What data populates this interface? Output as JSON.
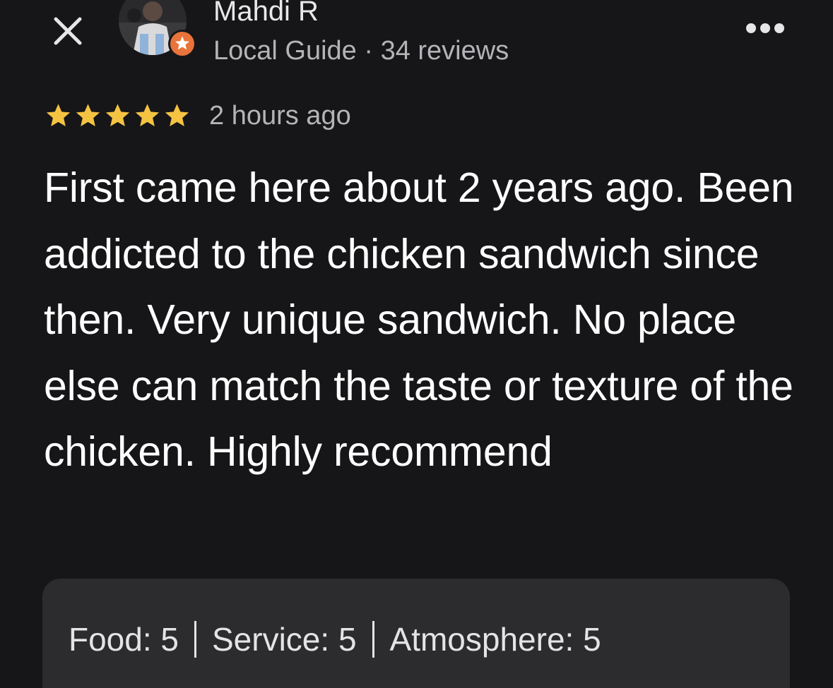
{
  "header": {
    "close_icon": "close-icon",
    "more_icon": "more-horizontal-icon",
    "badge_icon": "star-badge-icon",
    "badge_color": "#e8743b"
  },
  "author": {
    "name": "Mahdi R",
    "meta": "Local Guide · 34 reviews"
  },
  "review": {
    "rating": 5,
    "star_color": "#f5c342",
    "timestamp": "2 hours ago",
    "text": "First came here about 2 years ago. Been addicted to the chicken sandwich since then. Very unique sandwich. No place else can match the taste or texture of the chicken. Highly recommend"
  },
  "ratings": {
    "food": "Food: 5",
    "service": "Service: 5",
    "atmosphere": "Atmosphere: 5"
  }
}
